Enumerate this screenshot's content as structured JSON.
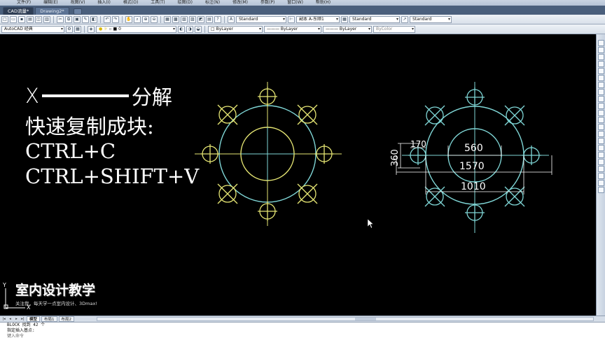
{
  "window": {
    "menu_items": [
      "文件(F)",
      "编辑(E)",
      "视图(V)",
      "插入(I)",
      "格式(O)",
      "工具(T)",
      "绘图(D)",
      "标注(N)",
      "修改(M)",
      "参数(P)",
      "窗口(W)",
      "帮助(H)"
    ],
    "tabs": [
      "CAD流量*",
      "Drawing2*"
    ]
  },
  "toolbar": {
    "text_style": "Standard",
    "dim_style": "副本 A-东顺1",
    "table_style": "Standard",
    "multileader_style": "Standard",
    "workspace": "AutoCAD 经典",
    "layer_value": "0",
    "color": "ByLayer",
    "linetype": "ByLayer",
    "lineweight": "ByLayer",
    "plot_style": "ByColor"
  },
  "canvas": {
    "text_line1_left": "X",
    "text_line1_right": "分解",
    "text_line2": "快速复制成块:",
    "text_line3": "CTRL+C",
    "text_line4": "CTRL+SHIFT+V",
    "dims": {
      "d560": "560",
      "d1570": "1570",
      "d1010": "1010",
      "d170": "170",
      "d360": "360"
    },
    "colors": {
      "yellow": "#e6e673",
      "cyan": "#7fd6d6",
      "dim": "#ffffff"
    }
  },
  "watermark": {
    "title": "室内设计教学",
    "subtitle": "关注我，每天学一点室内设计、3Dmax!"
  },
  "layout_tabs": [
    "模型",
    "布局1",
    "布局2"
  ],
  "command": {
    "line1": "BLOCK 找到 42 个",
    "line2": "指定插入基点:",
    "prompt": "键入命令"
  }
}
